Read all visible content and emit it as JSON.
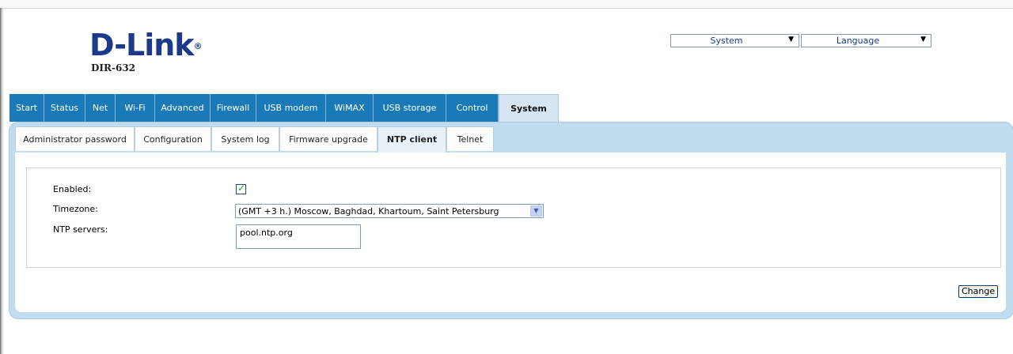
{
  "brand": {
    "logo": "D-Link",
    "model": "DIR-632"
  },
  "top_controls": {
    "system_select": "System",
    "language_select": "Language"
  },
  "main_tabs": [
    {
      "label": "Start"
    },
    {
      "label": "Status"
    },
    {
      "label": "Net"
    },
    {
      "label": "Wi-Fi"
    },
    {
      "label": "Advanced"
    },
    {
      "label": "Firewall"
    },
    {
      "label": "USB modem"
    },
    {
      "label": "WiMAX"
    },
    {
      "label": "USB storage"
    },
    {
      "label": "Control"
    },
    {
      "label": "System",
      "active": true
    }
  ],
  "sub_tabs": [
    {
      "label": "Administrator password"
    },
    {
      "label": "Configuration"
    },
    {
      "label": "System log"
    },
    {
      "label": "Firmware upgrade"
    },
    {
      "label": "NTP client",
      "active": true
    },
    {
      "label": "Telnet"
    }
  ],
  "form": {
    "enabled_label": "Enabled:",
    "enabled_checked": true,
    "timezone_label": "Timezone:",
    "timezone_value": "(GMT +3 h.) Moscow, Baghdad, Khartoum, Saint Petersburg",
    "ntp_label": "NTP servers:",
    "ntp_value": "pool.ntp.org"
  },
  "actions": {
    "change_label": "Change"
  },
  "icons": {
    "dropdown": "chevron-down-icon",
    "checkbox": "checkmark-icon"
  },
  "colors": {
    "brand": "#1b3a8a",
    "tab_bg": "#1a7ab8",
    "panel_bg": "#c2dcef"
  }
}
